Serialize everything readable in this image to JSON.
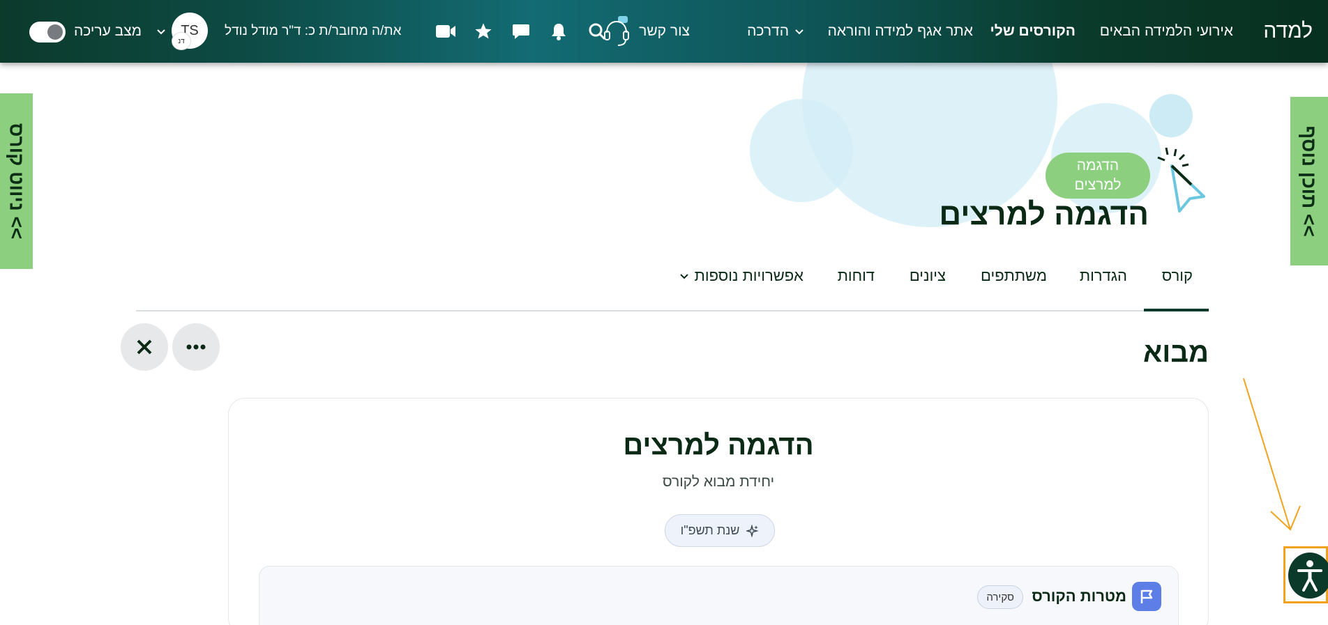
{
  "navbar": {
    "brand": "למדה",
    "links": [
      "אירועי הלמידה הבאים",
      "הקורסים שלי",
      "אתר אגף למידה והוראה",
      "הדרכה"
    ],
    "contact": "צור קשר",
    "user_text": "את/ה מחובר/ת כ: ד\"ר מודל נודל",
    "avatar_initials": "TS",
    "avatar_mini": "דנ",
    "edit_mode": "מצב עריכה"
  },
  "side_tabs": {
    "left": "ניווט קורס <<",
    "right": "תוכן נוסף <<"
  },
  "hero": {
    "pill": "הדגמה\nלמרצים",
    "title": "הדגמה למרצים"
  },
  "tabs": [
    "קורס",
    "הגדרות",
    "משתתפים",
    "ציונים",
    "דוחות",
    "אפשרויות נוספות"
  ],
  "section": {
    "title": "מבוא"
  },
  "card": {
    "title": "הדגמה למרצים",
    "subtitle": "יחידת מבוא לקורס",
    "year": "שנת תשפ\"ו",
    "goal_title": "מטרות הקורס",
    "goal_badge": "סקירה"
  },
  "colors": {
    "accent_green": "#8bcf7f",
    "dark_green": "#0b3a2a",
    "flag_blue": "#5c7ee6",
    "highlight_orange": "#f2a21b"
  }
}
